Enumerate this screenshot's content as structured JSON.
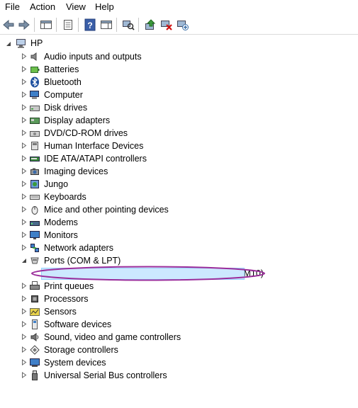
{
  "menu": {
    "file": "File",
    "action": "Action",
    "view": "View",
    "help": "Help"
  },
  "toolbar": {
    "buttons": [
      "back-icon",
      "forward-icon",
      "show-hide-tree-icon",
      "properties-icon",
      "help-icon",
      "action-pane-icon",
      "scan-hardware-icon",
      "update-driver-icon",
      "uninstall-device-icon",
      "add-legacy-hardware-icon"
    ]
  },
  "tree": {
    "root": "HP",
    "categories": [
      {
        "label": "Audio inputs and outputs",
        "icon": "speaker-icon"
      },
      {
        "label": "Batteries",
        "icon": "battery-icon"
      },
      {
        "label": "Bluetooth",
        "icon": "bluetooth-icon"
      },
      {
        "label": "Computer",
        "icon": "computer-icon"
      },
      {
        "label": "Disk drives",
        "icon": "disk-drive-icon"
      },
      {
        "label": "Display adapters",
        "icon": "display-adapter-icon"
      },
      {
        "label": "DVD/CD-ROM drives",
        "icon": "dvd-drive-icon"
      },
      {
        "label": "Human Interface Devices",
        "icon": "hid-icon"
      },
      {
        "label": "IDE ATA/ATAPI controllers",
        "icon": "ide-controller-icon"
      },
      {
        "label": "Imaging devices",
        "icon": "camera-icon"
      },
      {
        "label": "Jungo",
        "icon": "jungo-icon"
      },
      {
        "label": "Keyboards",
        "icon": "keyboard-icon"
      },
      {
        "label": "Mice and other pointing devices",
        "icon": "mouse-icon"
      },
      {
        "label": "Modems",
        "icon": "modem-icon"
      },
      {
        "label": "Monitors",
        "icon": "monitor-icon"
      },
      {
        "label": "Network adapters",
        "icon": "network-adapter-icon"
      },
      {
        "label": "Ports (COM & LPT)",
        "icon": "port-icon"
      },
      {
        "label": "Silicon Labs CP210x USB to UART Bridge (COM10)",
        "icon": "port-device-icon"
      },
      {
        "label": "Print queues",
        "icon": "printer-icon"
      },
      {
        "label": "Processors",
        "icon": "processor-icon"
      },
      {
        "label": "Sensors",
        "icon": "sensor-icon"
      },
      {
        "label": "Software devices",
        "icon": "software-device-icon"
      },
      {
        "label": "Sound, video and game controllers",
        "icon": "sound-icon"
      },
      {
        "label": "Storage controllers",
        "icon": "storage-controller-icon"
      },
      {
        "label": "System devices",
        "icon": "system-device-icon"
      },
      {
        "label": "Universal Serial Bus controllers",
        "icon": "usb-icon"
      }
    ]
  },
  "colors": {
    "selection_bg": "#cce8ff",
    "selection_border": "#99d1ff",
    "annotation_ellipse": "#9b2d9b"
  }
}
